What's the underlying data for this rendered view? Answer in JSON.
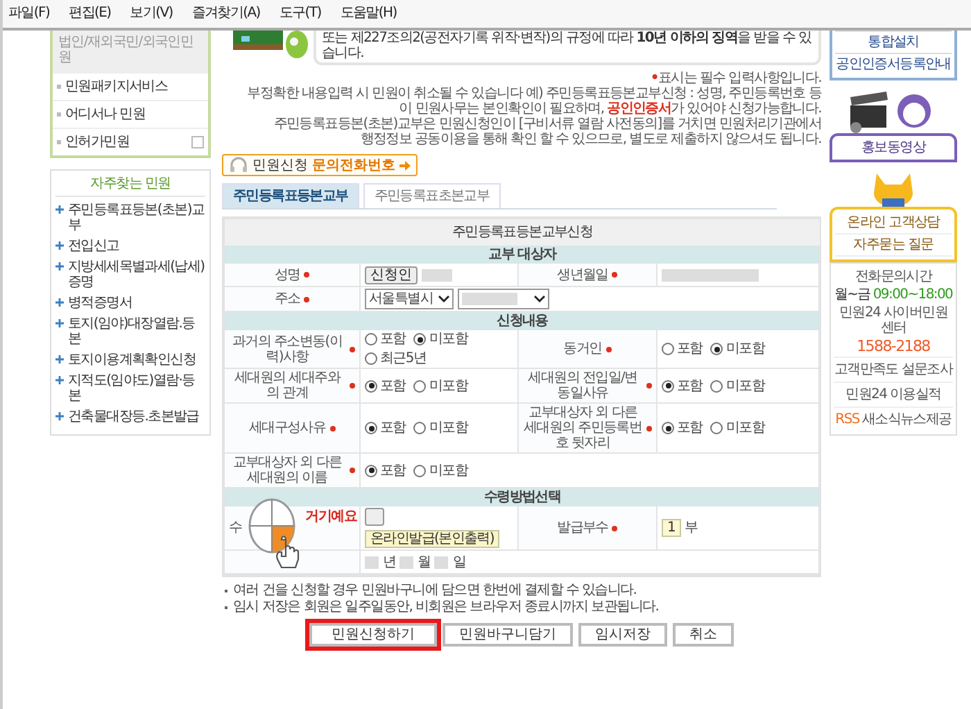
{
  "menu_bar": [
    "파일(F)",
    "편집(E)",
    "보기(V)",
    "즐겨찾기(A)",
    "도구(T)",
    "도움말(H)"
  ],
  "left_sidebar": {
    "header": "법인/재외국민/외국인민원",
    "items": [
      {
        "label": "민원패키지서비스",
        "expandable": false
      },
      {
        "label": "어디서나 민원",
        "expandable": false
      },
      {
        "label": "인허가민원",
        "expandable": true
      }
    ]
  },
  "favorites": {
    "title": "자주찾는 민원",
    "items": [
      "주민등록표등본(초본)교부",
      "전입신고",
      "지방세세목별과세(납세)증명",
      "병적증명서",
      "토지(임야)대장열람.등본",
      "토지이용계획확인신청",
      "지적도(임야도)열람·등본",
      "건축물대장등.초본발급"
    ]
  },
  "banner": {
    "text": "또는 제227조의2(공전자기록 위작·변작)의 규정에 따라 **10년 이하의 징역**을 받을 수 있습니다."
  },
  "notes": [
    "**•**표시는 필수 입력사항입니다.",
    "부정확한 내용입력 시 민원이 취소될 수 있습니다  예) 주민등록표등본교부신청 : 성명, 주민등록번호 등",
    "이 민원사무는 본인확인이 필요하며, **공인인증서**가 있어야 신청가능합니다.",
    "주민등록표등본(초본)교부은 민원신청인이 [구비서류 열람 사전동의]를 거치면 민원처리기관에서",
    "행정정보 공동이용을 통해 확인 할 수 있으므로, 별도로 제출하지 않으셔도 됩니다."
  ],
  "contact_button": {
    "label": "민원신청 **문의전화번호**"
  },
  "tabs": [
    {
      "label": "주민등록표등본교부",
      "selected": true
    },
    {
      "label": "주민등록표초본교부",
      "selected": false
    }
  ],
  "form": {
    "title": "주민등록표등본교부신청",
    "sections": [
      {
        "heading": "교부 대상자",
        "rows": [
          {
            "cells": [
              {
                "kind": "label",
                "text": "성명",
                "required": true
              },
              {
                "kind": "applicant",
                "button": "신청인"
              },
              {
                "kind": "label",
                "text": "생년월일",
                "required": true
              },
              {
                "kind": "masked"
              }
            ]
          },
          {
            "cells": [
              {
                "kind": "label",
                "text": "주소",
                "required": true
              },
              {
                "kind": "address",
                "city": "서울특별시"
              }
            ]
          }
        ]
      },
      {
        "heading": "신청내용",
        "rows": [
          {
            "cells": [
              {
                "kind": "label",
                "text": "과거의 주소변동(이력)사항",
                "required": true
              },
              {
                "kind": "radio",
                "options": [
                  {
                    "label": "포함",
                    "selected": false
                  },
                  {
                    "label": "미포함",
                    "selected": true
                  },
                  {
                    "label": "최근5년",
                    "selected": false
                  }
                ]
              },
              {
                "kind": "label",
                "text": "동거인",
                "required": true
              },
              {
                "kind": "radio",
                "options": [
                  {
                    "label": "포함",
                    "selected": false
                  },
                  {
                    "label": "미포함",
                    "selected": true
                  }
                ]
              }
            ]
          },
          {
            "cells": [
              {
                "kind": "label",
                "text": "세대원의 세대주와의 관계",
                "required": true
              },
              {
                "kind": "radio",
                "options": [
                  {
                    "label": "포함",
                    "selected": true
                  },
                  {
                    "label": "미포함",
                    "selected": false
                  }
                ]
              },
              {
                "kind": "label",
                "text": "세대원의 전입일/변동일사유",
                "required": true
              },
              {
                "kind": "radio",
                "options": [
                  {
                    "label": "포함",
                    "selected": true
                  },
                  {
                    "label": "미포함",
                    "selected": false
                  }
                ]
              }
            ]
          },
          {
            "cells": [
              {
                "kind": "label",
                "text": "세대구성사유",
                "required": true
              },
              {
                "kind": "radio",
                "options": [
                  {
                    "label": "포함",
                    "selected": true
                  },
                  {
                    "label": "미포함",
                    "selected": false
                  }
                ]
              },
              {
                "kind": "label",
                "text": "교부대상자 외 다른 세대원의 주민등록번호 뒷자리",
                "required": true
              },
              {
                "kind": "radio",
                "options": [
                  {
                    "label": "포함",
                    "selected": true
                  },
                  {
                    "label": "미포함",
                    "selected": false
                  }
                ]
              }
            ]
          },
          {
            "cells": [
              {
                "kind": "label",
                "text": "교부대상자 외 다른 세대원의 이름",
                "required": true
              },
              {
                "kind": "radio",
                "options": [
                  {
                    "label": "포함",
                    "selected": true
                  },
                  {
                    "label": "미포함",
                    "selected": false
                  }
                ]
              }
            ]
          }
        ]
      },
      {
        "heading": "수령방법선택",
        "rows": [
          {
            "cells": [
              {
                "kind": "label",
                "text": "수",
                "required": false,
                "annotated": true
              },
              {
                "kind": "receipt",
                "value": "온라인발급(본인출력)"
              },
              {
                "kind": "label",
                "text": "발급부수",
                "required": true
              },
              {
                "kind": "count",
                "value": "1",
                "unit": "부"
              }
            ]
          },
          {
            "cells": [
              {
                "kind": "blank"
              },
              {
                "kind": "date",
                "units": [
                  "년",
                  "월",
                  "일"
                ]
              }
            ]
          }
        ]
      }
    ]
  },
  "annotation": {
    "callout": "거기예요"
  },
  "footnotes": [
    "여러 건을 신청할 경우 민원바구니에 담으면 한번에 결제할 수 있습니다.",
    "임시 저장은 회원은 일주일동안, 비회원은 브라우저 종료시까지 보관됩니다."
  ],
  "actions": [
    {
      "label": "민원신청하기",
      "highlighted": true
    },
    {
      "label": "민원바구니담기",
      "highlighted": false
    },
    {
      "label": "임시저장",
      "highlighted": false
    },
    {
      "label": "취소",
      "highlighted": false
    }
  ],
  "right_sidebar": {
    "links": [
      "통합설치",
      "공인인증서등록안내"
    ],
    "video": "홍보동영상",
    "support": [
      "온라인 고객상담",
      "자주묻는 질문"
    ],
    "phone_hours_title": "전화문의시간",
    "phone_days": "월~금",
    "phone_hours": "09:00~18:00",
    "center": "민원24 사이버민원센터",
    "phone": "1588-2188",
    "info_links": [
      "고객만족도 설문조사",
      "민원24 이용실적"
    ],
    "rss_badge": "RSS",
    "rss_label": "새소식뉴스제공"
  }
}
